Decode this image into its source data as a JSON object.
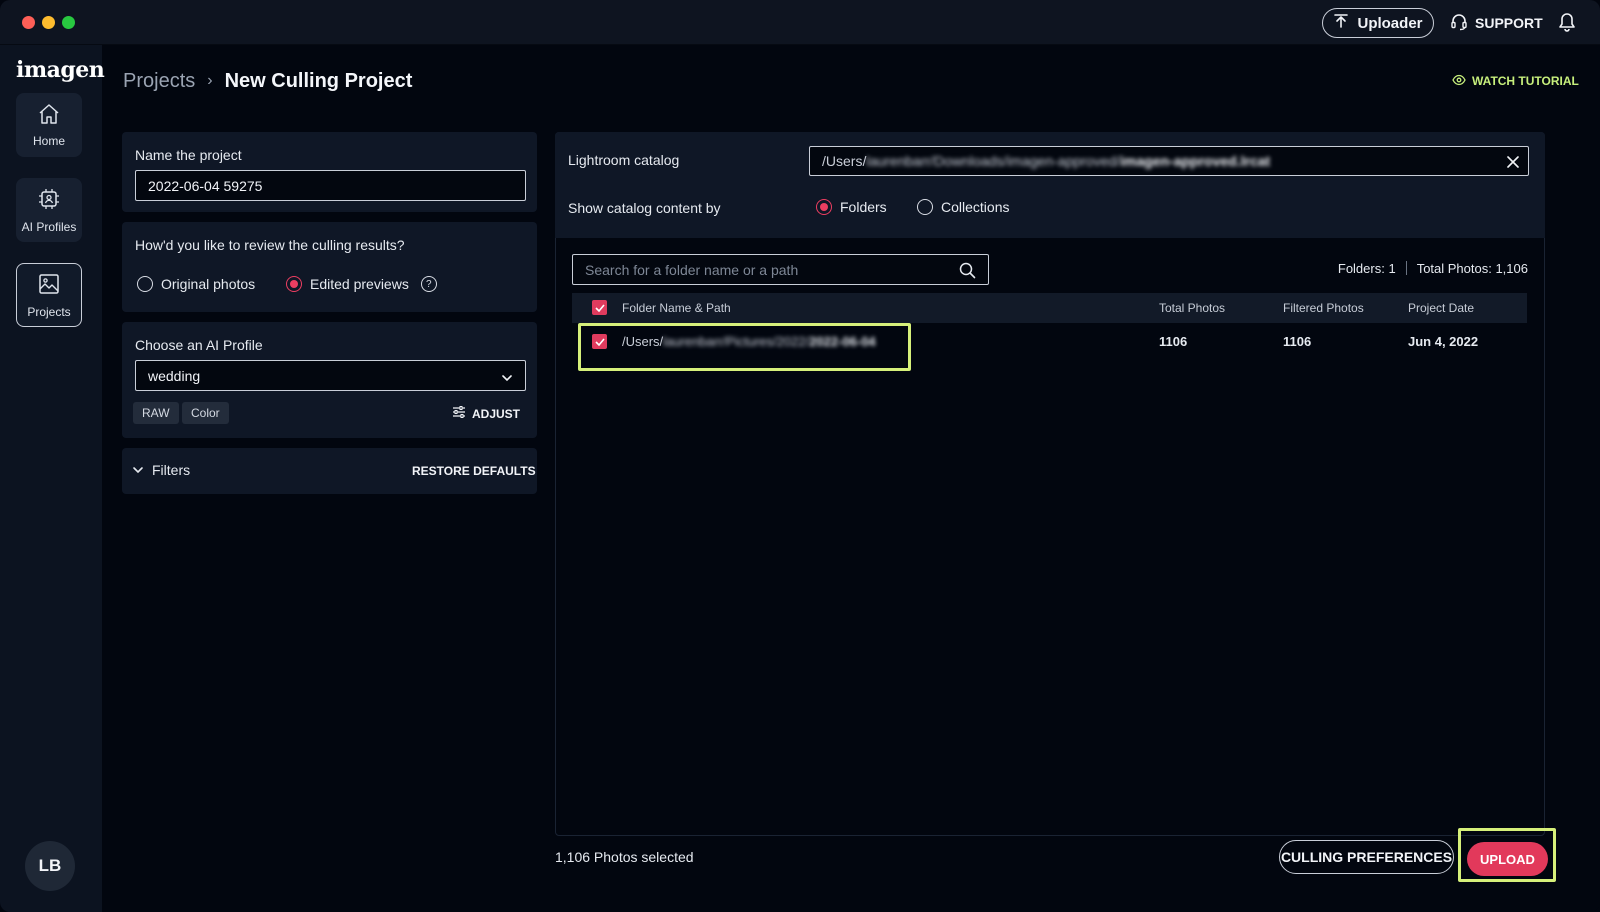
{
  "topbar": {
    "uploader_label": "Uploader",
    "support_label": "SUPPORT"
  },
  "sidebar": {
    "logo": "imagen",
    "items": [
      {
        "label": "Home",
        "icon": "home-icon"
      },
      {
        "label": "AI Profiles",
        "icon": "ai-chip-icon"
      },
      {
        "label": "Projects",
        "icon": "image-gallery-icon"
      }
    ],
    "avatar_initials": "LB"
  },
  "header": {
    "breadcrumb_root": "Projects",
    "breadcrumb_current": "New Culling Project",
    "watch_tutorial": "WATCH TUTORIAL"
  },
  "project": {
    "name_label": "Name the project",
    "name_value": "2022-06-04 59275",
    "review_question": "How'd you like to review the culling results?",
    "review_options": [
      "Original photos",
      "Edited previews"
    ],
    "review_selected": "Edited previews",
    "ai_profile_label": "Choose an AI Profile",
    "ai_profile_value": "wedding",
    "tags": [
      "RAW",
      "Color"
    ],
    "adjust_label": "ADJUST",
    "filters_label": "Filters",
    "restore_defaults": "RESTORE DEFAULTS"
  },
  "catalog": {
    "label": "Lightroom catalog",
    "path_prefix": "/Users/",
    "path_blurred": "laurenbarr/Downloads/imagen-approved/",
    "path_blurred_bold": "imagen-approved.lrcat",
    "show_by_label": "Show catalog content by",
    "show_by_options": [
      "Folders",
      "Collections"
    ],
    "show_by_selected": "Folders"
  },
  "folders": {
    "search_placeholder": "Search for a folder name or a path",
    "folders_count": "Folders: 1",
    "total_photos": "Total Photos: 1,106",
    "columns": [
      "Folder Name & Path",
      "Total Photos",
      "Filtered Photos",
      "Project Date"
    ],
    "rows": [
      {
        "path_prefix": "/Users/",
        "path_blurred": "laurenbarr/Pictures/2022/",
        "path_blurred_bold": "2022-06-04",
        "total": "1106",
        "filtered": "1106",
        "date": "Jun 4, 2022"
      }
    ]
  },
  "footer": {
    "photos_selected": "1,106 Photos selected",
    "culling_preferences": "CULLING PREFERENCES",
    "upload": "UPLOAD"
  },
  "colors": {
    "accent": "#e2395b",
    "highlight": "#d6f07a",
    "tutorial": "#c7ef7c",
    "background": "#02060f",
    "panel": "#0f1726"
  }
}
